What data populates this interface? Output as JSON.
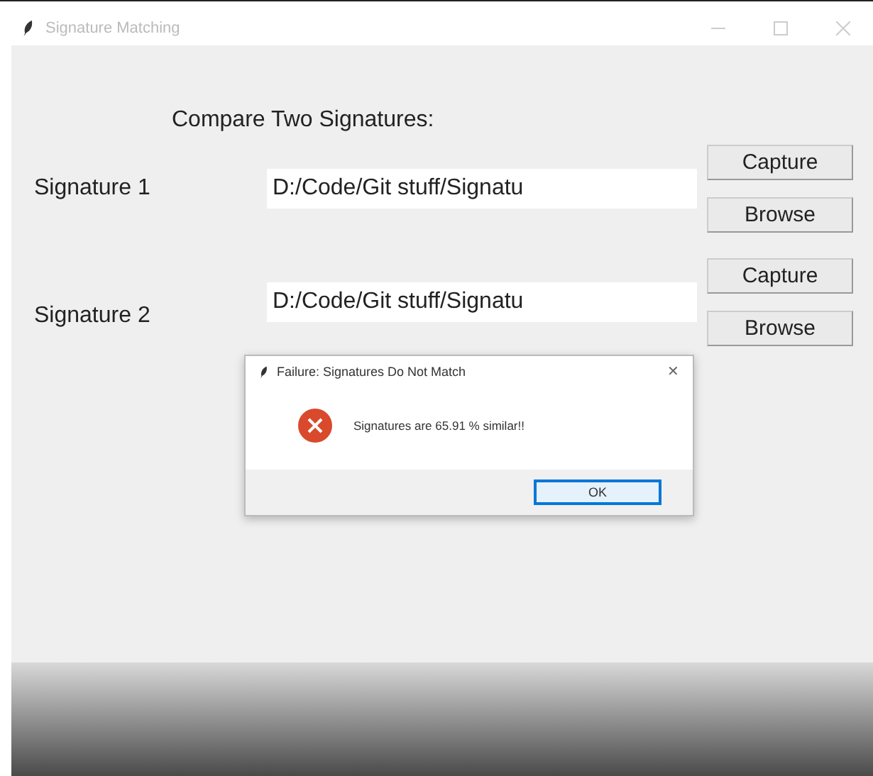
{
  "window": {
    "title": "Signature Matching"
  },
  "heading": "Compare Two Signatures:",
  "signatures": [
    {
      "label": "Signature 1",
      "path": "D:/Code/Git stuff/Signatu",
      "buttons": [
        "Capture",
        "Browse"
      ]
    },
    {
      "label": "Signature 2",
      "path": "D:/Code/Git stuff/Signatu",
      "buttons": [
        "Capture",
        "Browse"
      ]
    }
  ],
  "dialog": {
    "title": "Failure: Signatures Do Not Match",
    "close": "✕",
    "message": "Signatures are 65.91 % similar!!",
    "button": "OK"
  }
}
